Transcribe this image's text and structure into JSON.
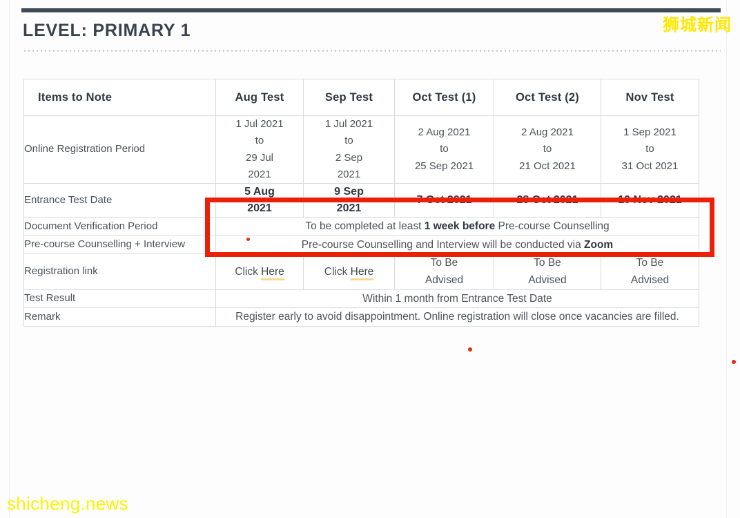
{
  "page": {
    "title": "LEVEL: PRIMARY 1",
    "accent_dark": "#3f4a55",
    "highlight_red": "#ec2008",
    "watermark_yellow": "#fff200"
  },
  "watermarks": {
    "top_right": "狮城新闻",
    "bottom_left": "shicheng.news"
  },
  "table": {
    "headers": [
      "Items to Note",
      "Aug Test",
      "Sep Test",
      "Oct Test (1)",
      "Oct Test (2)",
      "Nov Test"
    ],
    "rows": {
      "registration_period": {
        "label": "Online Registration Period",
        "aug": "1 Jul 2021\nto\n29 Jul\n2021",
        "aug_l1": "1 Jul 2021",
        "aug_l2": "to",
        "aug_l3": "29 Jul",
        "aug_l4": "2021",
        "sep_l1": "1 Jul 2021",
        "sep_l2": "to",
        "sep_l3": "2 Sep",
        "sep_l4": "2021",
        "oct1_l1": "2 Aug 2021",
        "oct1_l2": "to",
        "oct1_l3": "25 Sep 2021",
        "oct2_l1": "2 Aug 2021",
        "oct2_l2": "to",
        "oct2_l3": "21 Oct 2021",
        "nov_l1": "1 Sep 2021",
        "nov_l2": "to",
        "nov_l3": "31 Oct 2021"
      },
      "entrance_test_date": {
        "label": "Entrance Test Date",
        "aug_l1": "5 Aug",
        "aug_l2": "2021",
        "sep_l1": "9 Sep",
        "sep_l2": "2021",
        "oct1": "7 Oct 2021",
        "oct2": "28 Oct 2021",
        "nov": "10 Nov 2021"
      },
      "document_verification": {
        "label": "Document Verification Period",
        "text_pre": "To be completed at least ",
        "text_bold": "1 week before",
        "text_post": " Pre-course Counselling"
      },
      "precourse_counselling": {
        "label": "Pre-course Counselling + Interview",
        "text_pre": "Pre-course Counselling and Interview will be conducted via ",
        "text_bold": "Zoom"
      },
      "registration_link": {
        "label": "Registration link",
        "aug_prefix": "Click ",
        "aug_link": "Here",
        "sep_prefix": "Click ",
        "sep_link": "Here",
        "oct1_l1": "To Be",
        "oct1_l2": "Advised",
        "oct2_l1": "To Be",
        "oct2_l2": "Advised",
        "nov_l1": "To Be",
        "nov_l2": "Advised"
      },
      "test_result": {
        "label": "Test Result",
        "text": "Within 1 month from Entrance Test Date"
      },
      "remark": {
        "label": "Remark",
        "line1": "Register early to avoid disappointment. Online registration will close once",
        "line2": "vacancies are filled."
      }
    }
  }
}
